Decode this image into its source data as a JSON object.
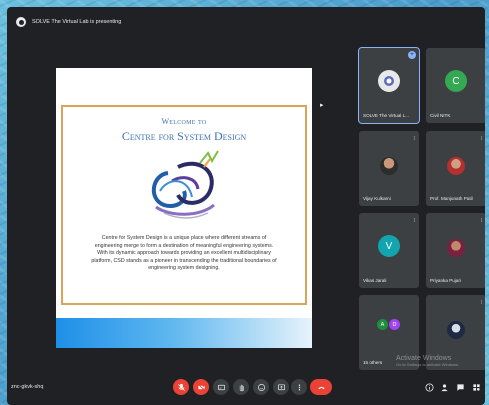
{
  "topbar": {
    "presenting_text": "SOLVE The Virtual Lab is presenting"
  },
  "slide": {
    "welcome": "Welcome to",
    "title": "Centre for System Design",
    "body": "Centre for System Design is a unique place where different streams of engineering merge to form a destination of meaningful engineering systems. With its dynamic approach towards providing an excellent multidisciplinary platform, CSD stands as a pioneer in transcending the traditional boundaries of engineering system designing."
  },
  "participants": [
    {
      "name": "SOLVE The Virtual L...",
      "avatar_type": "logo"
    },
    {
      "name": "Civil NITK",
      "initial": "C",
      "avatar_color": "#34a853"
    },
    {
      "name": "Vijay Kulkarni",
      "avatar_type": "photo"
    },
    {
      "name": "Prof. Manjunath Patil",
      "avatar_type": "photo"
    },
    {
      "name": "Vikas Jarali",
      "initial": "V",
      "avatar_color": "#12a4af"
    },
    {
      "name": "Priyanka Pujari",
      "avatar_type": "photo"
    },
    {
      "name": "15 others",
      "initials": [
        "A",
        "D"
      ],
      "avatar_colors": [
        "#1e8e3e",
        "#a142f4"
      ]
    },
    {
      "name": "",
      "avatar_type": "photo"
    }
  ],
  "bottombar": {
    "meeting_code": "znc-gkvk-shq"
  },
  "watermark": {
    "line1": "Activate Windows",
    "line2": "Go to Settings to activate Windows."
  },
  "colors": {
    "end_call": "#ea4335",
    "accent": "#8ab4f8",
    "tile_bg": "#3c4043",
    "surface": "#202124"
  },
  "icons": [
    "present-icon",
    "mic-off-icon",
    "camera-off-icon",
    "captions-icon",
    "raise-hand-icon",
    "present-now-icon",
    "more-options-icon",
    "end-call-icon",
    "info-icon",
    "people-icon",
    "chat-icon",
    "activities-icon"
  ]
}
